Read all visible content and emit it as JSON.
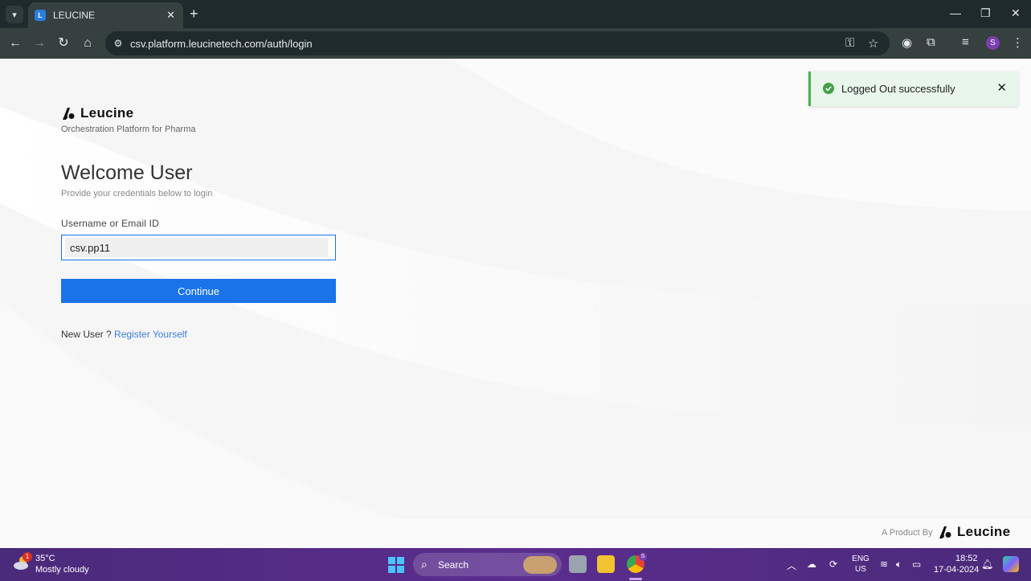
{
  "browser": {
    "tab_title": "LEUCINE",
    "tab_favicon_letter": "L",
    "url": "csv.platform.leucinetech.com/auth/login",
    "profile_initial": "S"
  },
  "page": {
    "brand_name": "Leucine",
    "tagline": "Orchestration Platform for Pharma",
    "welcome_title": "Welcome User",
    "welcome_subtitle": "Provide your credentials below to login",
    "username_label": "Username or Email ID",
    "username_value": "csv.pp11",
    "continue_label": "Continue",
    "new_user_text": "New User ?",
    "register_link": "Register Yourself",
    "footer_by": "A Product By",
    "footer_brand": "Leucine"
  },
  "toast": {
    "message": "Logged Out successfully",
    "status_color": "#4caf50"
  },
  "taskbar": {
    "weather_badge": "1",
    "temperature": "35°C",
    "weather_desc": "Mostly cloudy",
    "search_label": "Search",
    "chrome_badge": "S",
    "lang_line1": "ENG",
    "lang_line2": "US",
    "time": "18:52",
    "date": "17-04-2024"
  },
  "colors": {
    "primary": "#1a73e8",
    "link": "#3c7fd9",
    "taskbar": "#5b2d8e"
  }
}
